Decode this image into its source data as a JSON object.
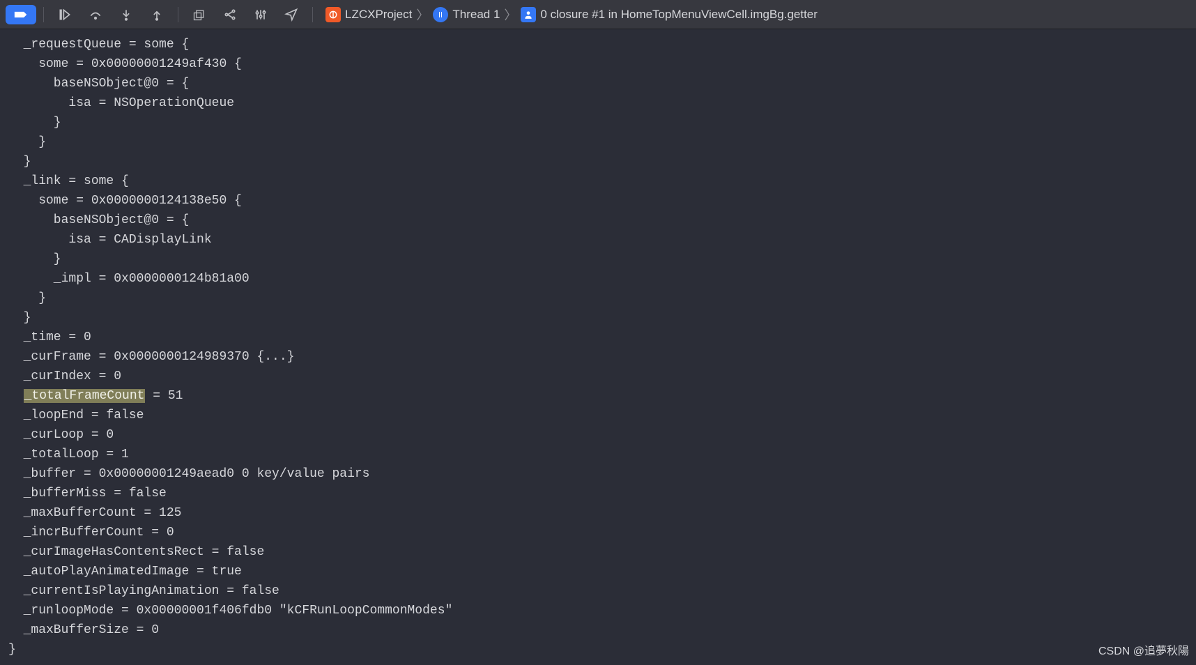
{
  "breadcrumb": {
    "project": "LZCXProject",
    "thread": "Thread 1",
    "frame": "0 closure #1 in HomeTopMenuViewCell.imgBg.getter"
  },
  "console": {
    "lines": [
      "  _requestQueue = some {",
      "    some = 0x00000001249af430 {",
      "      baseNSObject@0 = {",
      "        isa = NSOperationQueue",
      "      }",
      "    }",
      "  }",
      "  _link = some {",
      "    some = 0x0000000124138e50 {",
      "      baseNSObject@0 = {",
      "        isa = CADisplayLink",
      "      }",
      "      _impl = 0x0000000124b81a00",
      "    }",
      "  }",
      "  _time = 0",
      "  _curFrame = 0x0000000124989370 {...}",
      "  _curIndex = 0"
    ],
    "highlight_line": {
      "prefix": "  ",
      "highlight": "_totalFrameCount",
      "suffix": " = 51"
    },
    "lines2": [
      "  _loopEnd = false",
      "  _curLoop = 0",
      "  _totalLoop = 1",
      "  _buffer = 0x00000001249aead0 0 key/value pairs",
      "  _bufferMiss = false",
      "  _maxBufferCount = 125",
      "  _incrBufferCount = 0",
      "  _curImageHasContentsRect = false",
      "  _autoPlayAnimatedImage = true",
      "  _currentIsPlayingAnimation = false",
      "  _runloopMode = 0x00000001f406fdb0 \"kCFRunLoopCommonModes\"",
      "  _maxBufferSize = 0",
      "}"
    ]
  },
  "watermark": "CSDN @追夢秋陽"
}
